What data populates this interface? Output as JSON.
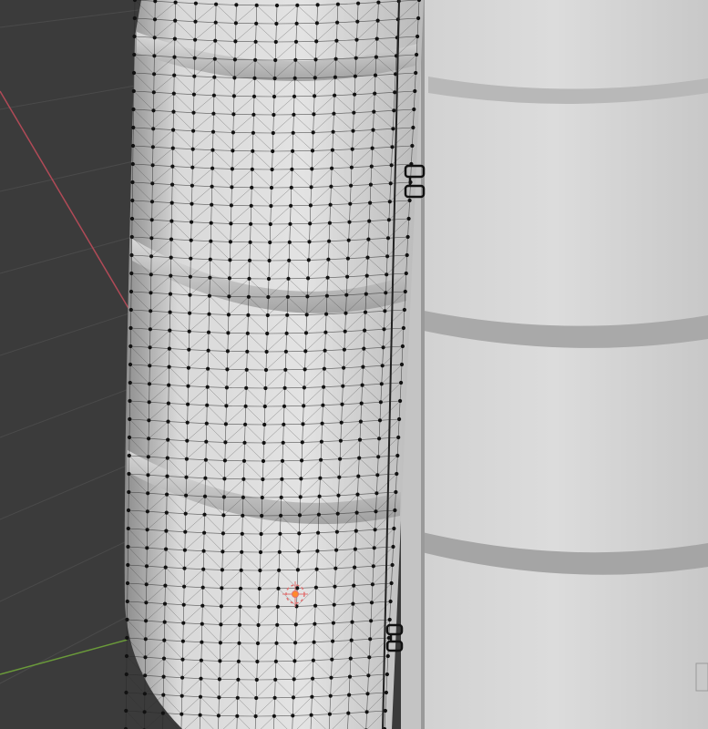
{
  "scene": {
    "background": "#3b3b3b",
    "grid_color": "#4a4a4a",
    "axis_x_color": "#b04a57",
    "axis_y_color": "#6a9a3a",
    "mesh_fill": "#cfcfcf",
    "mesh_wire": "#2a2a2a",
    "vertex_color": "#111111",
    "selected_vertex_color": "#ff8a2a",
    "origin_color": "#e07070"
  },
  "objects": [
    {
      "kind": "drum",
      "state": "edit-mode",
      "role": "wireframe-barrel"
    },
    {
      "kind": "drum",
      "state": "object-mode",
      "role": "shaded-barrel"
    }
  ],
  "icons": [
    "grab-handle-icon",
    "object-origin-icon"
  ]
}
